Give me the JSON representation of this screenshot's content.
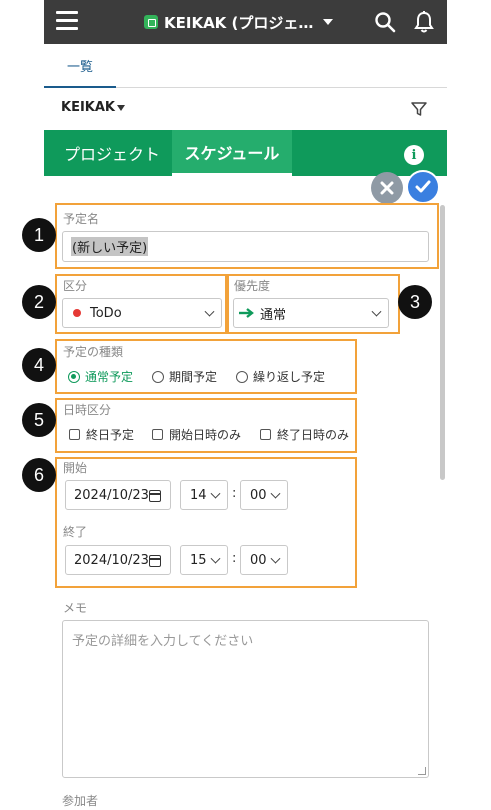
{
  "header": {
    "app_title": "KEIKAK (プロジェ…",
    "icons": [
      "hamburger-icon",
      "app-logo-icon",
      "chevron-down-icon",
      "search-icon",
      "bell-icon"
    ]
  },
  "tabs": {
    "list_label": "一覧"
  },
  "filter": {
    "label": "KEIKAK"
  },
  "green_tabs": {
    "project": "プロジェクト",
    "schedule": "スケジュール",
    "info": "i"
  },
  "form": {
    "title_label": "予定名",
    "title_value": "(新しい予定)",
    "category_label": "区分",
    "category_value": "ToDo",
    "priority_label": "優先度",
    "priority_value": "通常",
    "type_label": "予定の種類",
    "type_options": [
      "通常予定",
      "期間予定",
      "繰り返し予定"
    ],
    "type_selected": "通常予定",
    "date_kind_label": "日時区分",
    "date_kind_options": [
      "終日予定",
      "開始日時のみ",
      "終了日時のみ"
    ],
    "start_label": "開始",
    "start_date": "2024/10/23",
    "start_hour": "14",
    "start_min": "00",
    "end_label": "終了",
    "end_date": "2024/10/23",
    "end_hour": "15",
    "end_min": "00",
    "colon": ":",
    "memo_label": "メモ",
    "memo_placeholder": "予定の詳細を入力してください",
    "participants_label": "参加者"
  },
  "callouts": [
    "1",
    "2",
    "3",
    "4",
    "5",
    "6"
  ],
  "colors": {
    "green": "#0f9a5b",
    "topbar": "#3c3c3c",
    "highlight": "#f2a23a",
    "confirm": "#3a7fe0",
    "todo_dot": "#e53935",
    "priority_arrow": "#0f9a5b"
  }
}
